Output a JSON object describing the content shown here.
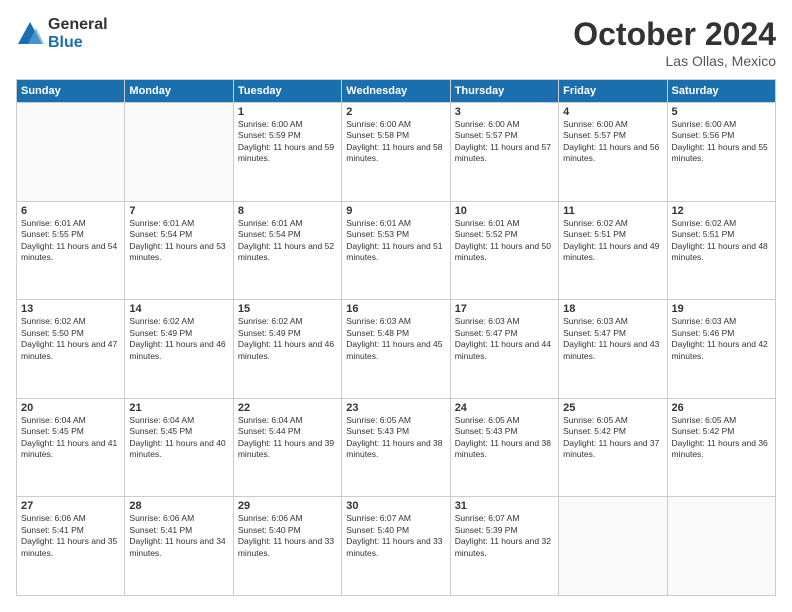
{
  "logo": {
    "general": "General",
    "blue": "Blue"
  },
  "title": "October 2024",
  "location": "Las Ollas, Mexico",
  "days_header": [
    "Sunday",
    "Monday",
    "Tuesday",
    "Wednesday",
    "Thursday",
    "Friday",
    "Saturday"
  ],
  "weeks": [
    [
      {
        "day": "",
        "info": ""
      },
      {
        "day": "",
        "info": ""
      },
      {
        "day": "1",
        "info": "Sunrise: 6:00 AM\nSunset: 5:59 PM\nDaylight: 11 hours and 59 minutes."
      },
      {
        "day": "2",
        "info": "Sunrise: 6:00 AM\nSunset: 5:58 PM\nDaylight: 11 hours and 58 minutes."
      },
      {
        "day": "3",
        "info": "Sunrise: 6:00 AM\nSunset: 5:57 PM\nDaylight: 11 hours and 57 minutes."
      },
      {
        "day": "4",
        "info": "Sunrise: 6:00 AM\nSunset: 5:57 PM\nDaylight: 11 hours and 56 minutes."
      },
      {
        "day": "5",
        "info": "Sunrise: 6:00 AM\nSunset: 5:56 PM\nDaylight: 11 hours and 55 minutes."
      }
    ],
    [
      {
        "day": "6",
        "info": "Sunrise: 6:01 AM\nSunset: 5:55 PM\nDaylight: 11 hours and 54 minutes."
      },
      {
        "day": "7",
        "info": "Sunrise: 6:01 AM\nSunset: 5:54 PM\nDaylight: 11 hours and 53 minutes."
      },
      {
        "day": "8",
        "info": "Sunrise: 6:01 AM\nSunset: 5:54 PM\nDaylight: 11 hours and 52 minutes."
      },
      {
        "day": "9",
        "info": "Sunrise: 6:01 AM\nSunset: 5:53 PM\nDaylight: 11 hours and 51 minutes."
      },
      {
        "day": "10",
        "info": "Sunrise: 6:01 AM\nSunset: 5:52 PM\nDaylight: 11 hours and 50 minutes."
      },
      {
        "day": "11",
        "info": "Sunrise: 6:02 AM\nSunset: 5:51 PM\nDaylight: 11 hours and 49 minutes."
      },
      {
        "day": "12",
        "info": "Sunrise: 6:02 AM\nSunset: 5:51 PM\nDaylight: 11 hours and 48 minutes."
      }
    ],
    [
      {
        "day": "13",
        "info": "Sunrise: 6:02 AM\nSunset: 5:50 PM\nDaylight: 11 hours and 47 minutes."
      },
      {
        "day": "14",
        "info": "Sunrise: 6:02 AM\nSunset: 5:49 PM\nDaylight: 11 hours and 46 minutes."
      },
      {
        "day": "15",
        "info": "Sunrise: 6:02 AM\nSunset: 5:49 PM\nDaylight: 11 hours and 46 minutes."
      },
      {
        "day": "16",
        "info": "Sunrise: 6:03 AM\nSunset: 5:48 PM\nDaylight: 11 hours and 45 minutes."
      },
      {
        "day": "17",
        "info": "Sunrise: 6:03 AM\nSunset: 5:47 PM\nDaylight: 11 hours and 44 minutes."
      },
      {
        "day": "18",
        "info": "Sunrise: 6:03 AM\nSunset: 5:47 PM\nDaylight: 11 hours and 43 minutes."
      },
      {
        "day": "19",
        "info": "Sunrise: 6:03 AM\nSunset: 5:46 PM\nDaylight: 11 hours and 42 minutes."
      }
    ],
    [
      {
        "day": "20",
        "info": "Sunrise: 6:04 AM\nSunset: 5:45 PM\nDaylight: 11 hours and 41 minutes."
      },
      {
        "day": "21",
        "info": "Sunrise: 6:04 AM\nSunset: 5:45 PM\nDaylight: 11 hours and 40 minutes."
      },
      {
        "day": "22",
        "info": "Sunrise: 6:04 AM\nSunset: 5:44 PM\nDaylight: 11 hours and 39 minutes."
      },
      {
        "day": "23",
        "info": "Sunrise: 6:05 AM\nSunset: 5:43 PM\nDaylight: 11 hours and 38 minutes."
      },
      {
        "day": "24",
        "info": "Sunrise: 6:05 AM\nSunset: 5:43 PM\nDaylight: 11 hours and 38 minutes."
      },
      {
        "day": "25",
        "info": "Sunrise: 6:05 AM\nSunset: 5:42 PM\nDaylight: 11 hours and 37 minutes."
      },
      {
        "day": "26",
        "info": "Sunrise: 6:05 AM\nSunset: 5:42 PM\nDaylight: 11 hours and 36 minutes."
      }
    ],
    [
      {
        "day": "27",
        "info": "Sunrise: 6:06 AM\nSunset: 5:41 PM\nDaylight: 11 hours and 35 minutes."
      },
      {
        "day": "28",
        "info": "Sunrise: 6:06 AM\nSunset: 5:41 PM\nDaylight: 11 hours and 34 minutes."
      },
      {
        "day": "29",
        "info": "Sunrise: 6:06 AM\nSunset: 5:40 PM\nDaylight: 11 hours and 33 minutes."
      },
      {
        "day": "30",
        "info": "Sunrise: 6:07 AM\nSunset: 5:40 PM\nDaylight: 11 hours and 33 minutes."
      },
      {
        "day": "31",
        "info": "Sunrise: 6:07 AM\nSunset: 5:39 PM\nDaylight: 11 hours and 32 minutes."
      },
      {
        "day": "",
        "info": ""
      },
      {
        "day": "",
        "info": ""
      }
    ]
  ]
}
